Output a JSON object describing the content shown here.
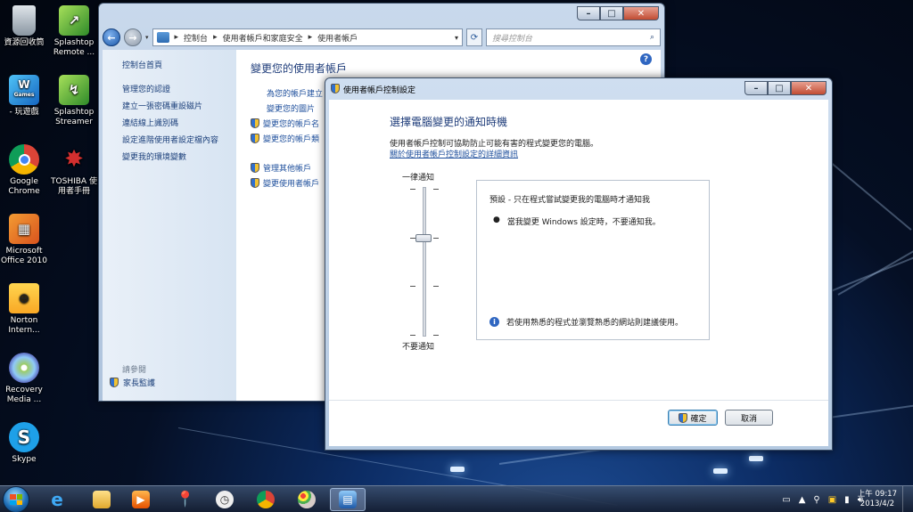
{
  "desktop": {
    "icons": [
      {
        "label": "資源回收筒"
      },
      {
        "label": "Splashtop Remote ..."
      },
      {
        "label": "- 玩遊戲"
      },
      {
        "label": "Splashtop Streamer"
      },
      {
        "label": "Google Chrome"
      },
      {
        "label": "TOSHIBA 使用者手冊"
      },
      {
        "label": "Microsoft Office 2010"
      },
      {
        "label": "Norton Intern..."
      },
      {
        "label": "Recovery Media ..."
      },
      {
        "label": "Skype"
      }
    ],
    "games_badge": "Games"
  },
  "control_panel": {
    "breadcrumb": [
      "控制台",
      "使用者帳戶和家庭安全",
      "使用者帳戶"
    ],
    "search_placeholder": "搜尋控制台",
    "sidebar": {
      "home": "控制台首頁",
      "links": [
        "管理您的認證",
        "建立一張密碼重設磁片",
        "連結線上識別碼",
        "設定進階使用者設定檔內容",
        "變更我的環境變數"
      ],
      "see_also": "請參閱",
      "family_safety": "家長監護"
    },
    "main": {
      "title": "變更您的使用者帳戶",
      "links": [
        {
          "label": "為您的帳戶建立",
          "shield": false
        },
        {
          "label": "變更您的圖片",
          "shield": false
        },
        {
          "label": "變更您的帳戶名",
          "shield": true
        },
        {
          "label": "變更您的帳戶類",
          "shield": true
        },
        {
          "label": "管理其他帳戶",
          "shield": true
        },
        {
          "label": "變更使用者帳戶",
          "shield": true
        }
      ]
    }
  },
  "uac_dialog": {
    "title": "使用者帳戶控制設定",
    "heading": "選擇電腦變更的通知時機",
    "description": "使用者帳戶控制可協助防止可能有害的程式變更您的電腦。",
    "more_link": "關於使用者帳戶控制設定的詳細資訊",
    "slider": {
      "top_label": "一律通知",
      "bottom_label": "不要通知",
      "levels": 4,
      "selected_level_from_bottom": 3
    },
    "info": {
      "title": "預設 - 只在程式嘗試變更我的電腦時才通知我",
      "bullet": "當我變更 Windows 設定時，不要通知我。",
      "note": "若使用熟悉的程式並瀏覽熟悉的網站則建議使用。"
    },
    "ok_label": "確定",
    "cancel_label": "取消"
  },
  "taskbar": {
    "time": "上午 09:17",
    "date": "2013/4/2"
  }
}
